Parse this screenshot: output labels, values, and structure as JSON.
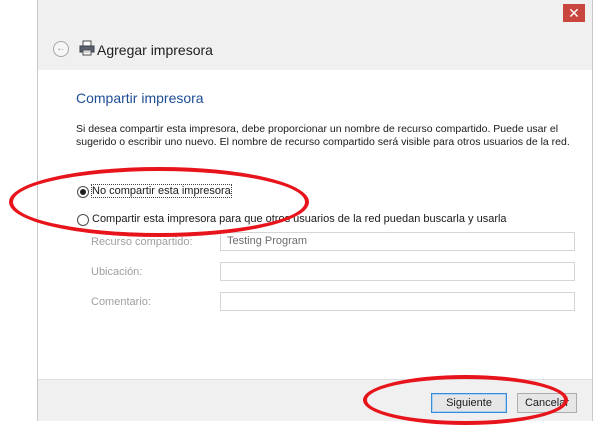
{
  "titlebar": {
    "close_label": "✕"
  },
  "header": {
    "title": "Agregar impresora",
    "back_icon": "arrow-left-icon",
    "printer_icon": "printer-icon"
  },
  "page": {
    "heading": "Compartir impresora",
    "description": "Si desea compartir esta impresora, debe proporcionar un nombre de recurso compartido. Puede usar el sugerido o escribir uno nuevo. El nombre de recurso compartido será visible para otros usuarios de la red.",
    "options": [
      {
        "label": "No compartir esta impresora",
        "selected": true
      },
      {
        "label": "Compartir esta impresora para que otros usuarios de la red puedan buscarla y usarla",
        "selected": false
      }
    ],
    "fields": {
      "share_label": "Recurso compartido:",
      "share_value": "Testing Program",
      "location_label": "Ubicación:",
      "location_value": "",
      "comment_label": "Comentario:",
      "comment_value": ""
    }
  },
  "footer": {
    "next_label": "Siguiente",
    "cancel_label": "Cancelar"
  },
  "colors": {
    "accent": "#1f4e96",
    "close": "#c8463e",
    "annotation": "#e8141c"
  }
}
